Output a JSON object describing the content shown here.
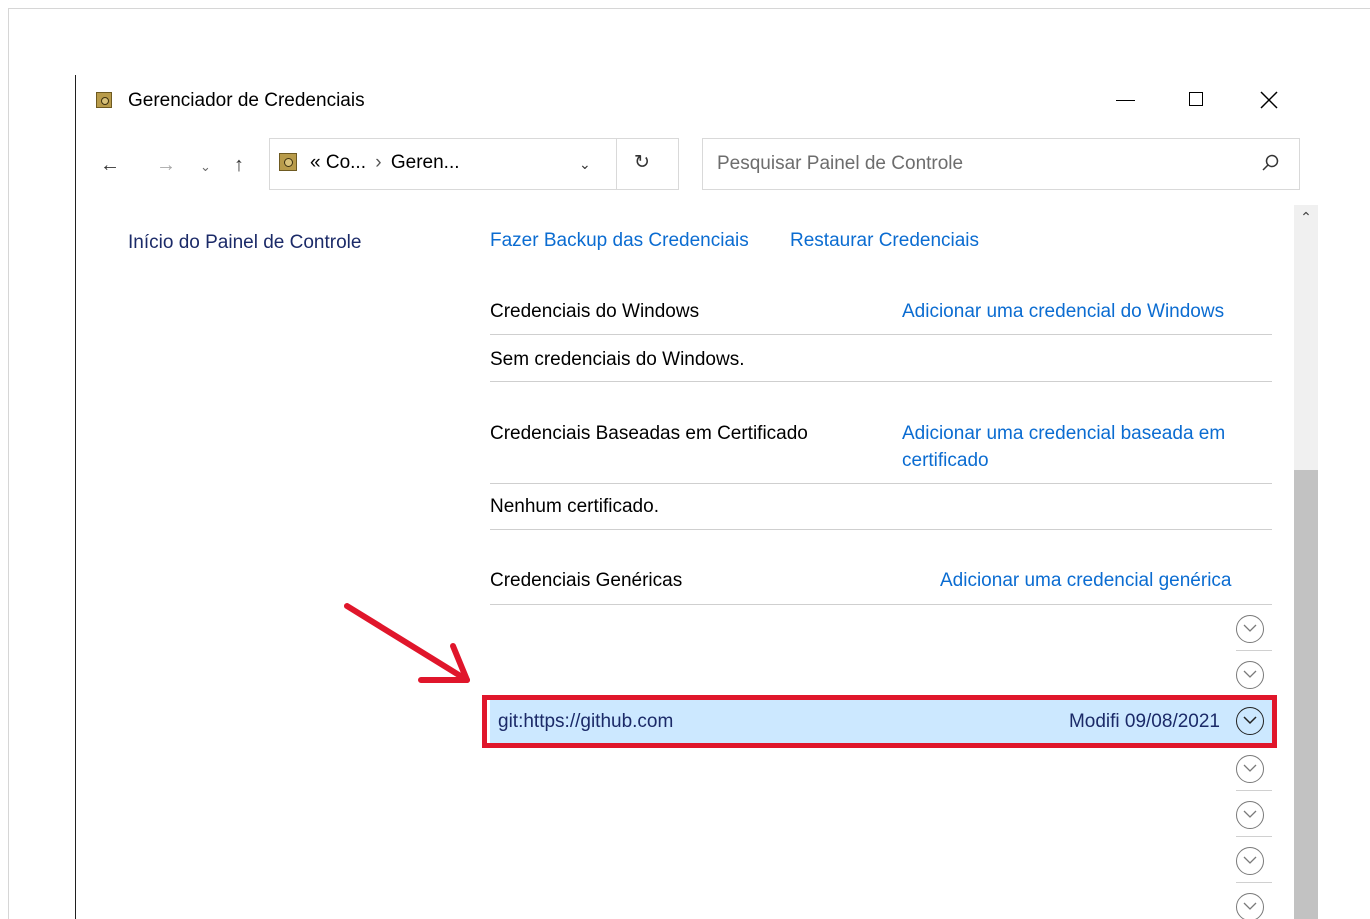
{
  "window": {
    "title": "Gerenciador de Credenciais"
  },
  "navbar": {
    "back_glyph": "←",
    "forward_glyph": "→",
    "recent_glyph": "⌄",
    "up_glyph": "↑",
    "address_prefix": "«",
    "address_part1": "Co...",
    "address_chevron": "›",
    "address_part2": "Geren...",
    "dropdown_glyph": "⌄",
    "refresh_glyph": "↻",
    "search_placeholder": "Pesquisar Painel de Controle"
  },
  "sidebar": {
    "home_link": "Início do Painel de Controle"
  },
  "toolbar": {
    "backup_link": "Fazer Backup das Credenciais",
    "restore_link": "Restaurar Credenciais"
  },
  "sections": {
    "windows": {
      "title": "Credenciais do Windows",
      "add_link": "Adicionar uma credencial do Windows",
      "empty_text": "Sem credenciais do Windows."
    },
    "certificate": {
      "title": "Credenciais Baseadas em Certificado",
      "add_link": "Adicionar uma credencial baseada em certificado",
      "empty_text": "Nenhum certificado."
    },
    "generic": {
      "title": "Credenciais Genéricas",
      "add_link": "Adicionar uma credencial genérica",
      "selected_item": {
        "name": "git:https://github.com",
        "modified": "Modifi 09/08/2021"
      }
    }
  },
  "scrollbar": {
    "up_glyph": "⌃"
  },
  "colors": {
    "link": "#0b6cd1",
    "selection": "#cce8ff",
    "annotation": "#e0162b"
  }
}
